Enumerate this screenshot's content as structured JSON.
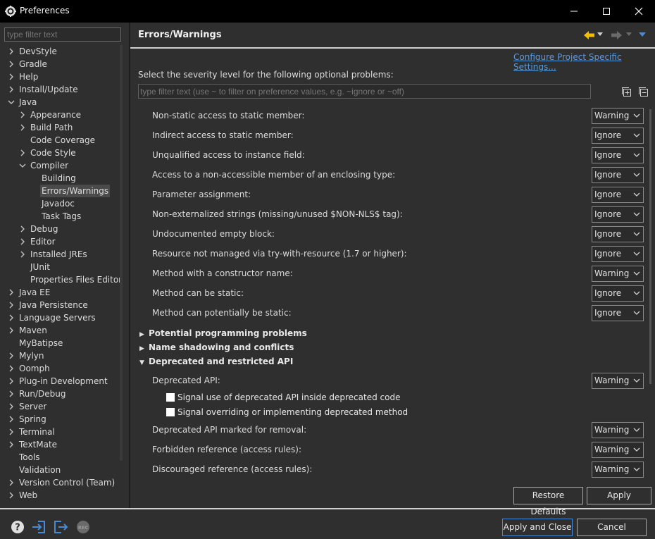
{
  "window": {
    "title": "Preferences",
    "minimize_icon": "minimize-icon",
    "maximize_icon": "maximize-icon",
    "close_icon": "close-icon"
  },
  "left": {
    "filter_placeholder": "type filter text",
    "tree": [
      {
        "label": "DevStyle",
        "arrow": "right"
      },
      {
        "label": "Gradle",
        "arrow": "right"
      },
      {
        "label": "Help",
        "arrow": "right"
      },
      {
        "label": "Install/Update",
        "arrow": "right"
      },
      {
        "label": "Java",
        "arrow": "down"
      },
      {
        "label": "Appearance",
        "arrow": "right"
      },
      {
        "label": "Build Path",
        "arrow": "right"
      },
      {
        "label": "Code Coverage",
        "arrow": ""
      },
      {
        "label": "Code Style",
        "arrow": "right"
      },
      {
        "label": "Compiler",
        "arrow": "down"
      },
      {
        "label": "Building",
        "arrow": ""
      },
      {
        "label": "Errors/Warnings",
        "arrow": "",
        "selected": true
      },
      {
        "label": "Javadoc",
        "arrow": ""
      },
      {
        "label": "Task Tags",
        "arrow": ""
      },
      {
        "label": "Debug",
        "arrow": "right"
      },
      {
        "label": "Editor",
        "arrow": "right"
      },
      {
        "label": "Installed JREs",
        "arrow": "right"
      },
      {
        "label": "JUnit",
        "arrow": ""
      },
      {
        "label": "Properties Files Editor",
        "arrow": ""
      },
      {
        "label": "Java EE",
        "arrow": "right"
      },
      {
        "label": "Java Persistence",
        "arrow": "right"
      },
      {
        "label": "Language Servers",
        "arrow": "right"
      },
      {
        "label": "Maven",
        "arrow": "right"
      },
      {
        "label": "MyBatipse",
        "arrow": ""
      },
      {
        "label": "Mylyn",
        "arrow": "right"
      },
      {
        "label": "Oomph",
        "arrow": "right"
      },
      {
        "label": "Plug-in Development",
        "arrow": "right"
      },
      {
        "label": "Run/Debug",
        "arrow": "right"
      },
      {
        "label": "Server",
        "arrow": "right"
      },
      {
        "label": "Spring",
        "arrow": "right"
      },
      {
        "label": "Terminal",
        "arrow": "right"
      },
      {
        "label": "TextMate",
        "arrow": "right"
      },
      {
        "label": "Tools",
        "arrow": ""
      },
      {
        "label": "Validation",
        "arrow": ""
      },
      {
        "label": "Version Control (Team)",
        "arrow": "right"
      },
      {
        "label": "Web",
        "arrow": "right"
      }
    ]
  },
  "right": {
    "page_title": "Errors/Warnings",
    "config_link": "Configure Project Specific Settings...",
    "severity_label": "Select the severity level for the following optional problems:",
    "filter_placeholder": "type filter text (use ~ to filter on preference values, e.g. ~ignore or ~off)",
    "options": [
      {
        "label": "Non-static access to static member:",
        "value": "Warning"
      },
      {
        "label": "Indirect access to static member:",
        "value": "Ignore"
      },
      {
        "label": "Unqualified access to instance field:",
        "value": "Ignore"
      },
      {
        "label": "Access to a non-accessible member of an enclosing type:",
        "value": "Ignore"
      },
      {
        "label": "Parameter assignment:",
        "value": "Ignore"
      },
      {
        "label": "Non-externalized strings (missing/unused $NON-NLS$ tag):",
        "value": "Ignore"
      },
      {
        "label": "Undocumented empty block:",
        "value": "Ignore"
      },
      {
        "label": "Resource not managed via try-with-resource (1.7 or higher):",
        "value": "Ignore"
      },
      {
        "label": "Method with a constructor name:",
        "value": "Warning"
      },
      {
        "label": "Method can be static:",
        "value": "Ignore"
      },
      {
        "label": "Method can potentially be static:",
        "value": "Ignore"
      }
    ],
    "sections": [
      {
        "label": "Potential programming problems",
        "expanded": false
      },
      {
        "label": "Name shadowing and conflicts",
        "expanded": false
      },
      {
        "label": "Deprecated and restricted API",
        "expanded": true
      }
    ],
    "deprecated": {
      "api_label": "Deprecated API:",
      "api_value": "Warning",
      "checkbox1": "Signal use of deprecated API inside deprecated code",
      "checkbox2": "Signal overriding or implementing deprecated method",
      "removal_label": "Deprecated API marked for removal:",
      "removal_value": "Warning",
      "forbidden_label": "Forbidden reference (access rules):",
      "forbidden_value": "Warning",
      "discouraged_label": "Discouraged reference (access rules):",
      "discouraged_value": "Warning"
    },
    "restore_defaults": "Restore Defaults",
    "apply": "Apply"
  },
  "footer": {
    "apply_and_close": "Apply and Close",
    "cancel": "Cancel",
    "icons": [
      "help-icon",
      "import-icon",
      "export-icon",
      "record-icon"
    ]
  },
  "colors": {
    "accent": "#4a8ad4",
    "link": "#5e9ad8",
    "nav_arrow": "#f0c000"
  }
}
